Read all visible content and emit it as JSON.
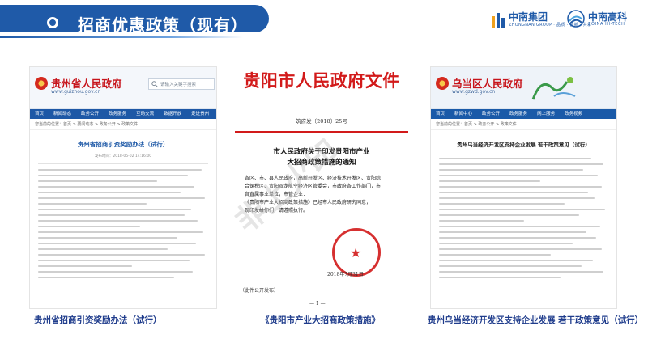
{
  "header": {
    "title": "招商优惠政策（现有）",
    "logo1": {
      "cn": "中南集团",
      "en": "ZHONGNAN GROUP · 品质 · 创新 · 共享"
    },
    "logo2": {
      "cn": "中南高科",
      "en": "ZOINA HI-TECH"
    }
  },
  "panel1": {
    "site_name": "贵州省人民政府",
    "site_url": "www.guizhou.gov.cn",
    "search_placeholder": "请输入关键字搜索",
    "nav": [
      "首页",
      "新闻动态",
      "政务公开",
      "政务服务",
      "互动交流",
      "数据开放",
      "走进贵州"
    ],
    "breadcrumb": "您当前的位置：首页 > 要闻动态 > 政务公开 > 政策文件",
    "doc_title": "贵州省招商引资奖励办法（试行）",
    "meta": "发布时间：2018-05-02 14:16:00"
  },
  "panel2": {
    "head": "贵阳市人民政府文件",
    "doc_no": "筑府发〔2018〕25号",
    "subject_line1": "市人民政府关于印发贵阳市产业",
    "subject_line2": "大招商政策措施的通知",
    "body": [
      "各区、市、县人民政府，高新开发区、经济技术开发区、贵阳综",
      "合保税区、贵阳双龙航空经济区管委会，市政府各工作部门，市",
      "各直属事业单位，市管企业：",
      "《贵阳市产业大招商政策措施》已经市人民政府研究同意，",
      "现印发给你们，请遵照执行。"
    ],
    "date": "2018年7月31日",
    "footnote": "（此件公开发布）",
    "page": "— 1 —"
  },
  "panel3": {
    "site_name": "乌当区人民政府",
    "site_url": "www.gzwd.gov.cn",
    "nav": [
      "首页",
      "新闻中心",
      "政务公开",
      "政务服务",
      "网上服务",
      "政务视频"
    ],
    "breadcrumb": "您当前的位置：首页 > 政务公开 > 政策文件",
    "doc_title": "贵州乌当经济开发区支持企业发展 若干政策意见（试行）"
  },
  "watermark": "非上火印",
  "captions": [
    "贵州省招商引资奖励办法（试行）",
    "《贵阳市产业大招商政策措施》",
    "贵州乌当经济开发区支持企业发展 若干政策意见（试行）"
  ],
  "colors": {
    "brand_blue": "#1f5aa8",
    "gov_red": "#d21a1a",
    "caption_blue": "#1f3c8c"
  }
}
